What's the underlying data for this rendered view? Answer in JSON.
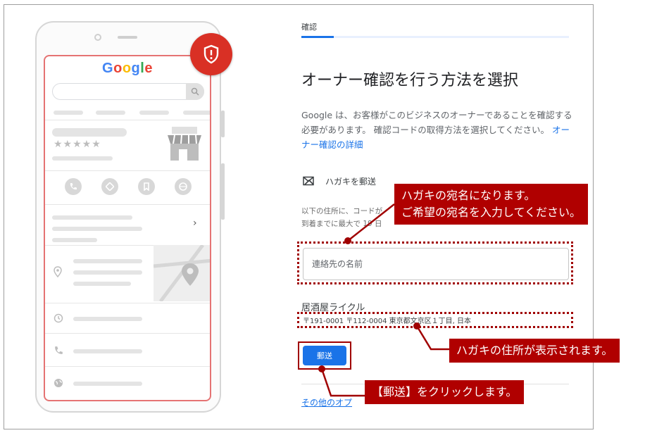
{
  "phone": {
    "logo": [
      "G",
      "o",
      "o",
      "g",
      "l",
      "e"
    ],
    "logo_colors": [
      "#4285F4",
      "#EA4335",
      "#FBBC05",
      "#4285F4",
      "#34A853",
      "#EA4335"
    ],
    "stars": "★★★★★",
    "chevron": "›"
  },
  "verify": {
    "tab_label": "確認",
    "title": "オーナー確認を行う方法を選択",
    "description": "Google は、お客様がこのビジネスのオーナーであることを確認する必要があります。 確認コードの取得方法を選択してください。",
    "details_link": "オーナー確認の詳細",
    "method_label": "ハガキを郵送",
    "sub_line1": "以下の住所に、コードが",
    "sub_line2": "到着までに最大で 19 日",
    "name_placeholder": "連絡先の名前",
    "business_name": "居酒屋ライクル",
    "address": "〒191-0001 〒112-0004 東京都文京区１丁目, 日本",
    "send_button": "郵送",
    "other_options_link": "その他のオプ"
  },
  "annotations": {
    "callout_name_line1": "ハガキの宛名になります。",
    "callout_name_line2": "ご希望の宛名を入力してください。",
    "callout_address": "ハガキの住所が表示されます。",
    "callout_send": "【郵送】をクリックします。"
  },
  "colors": {
    "accent": "#1a73e8",
    "annotation": "#b00000",
    "shield": "#d93025"
  }
}
